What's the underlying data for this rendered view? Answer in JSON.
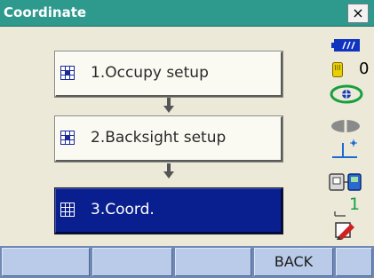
{
  "window": {
    "title": "Coordinate",
    "close_label": "×"
  },
  "menu": [
    {
      "label": "1.Occupy setup",
      "selected": false
    },
    {
      "label": "2.Backsight setup",
      "selected": false
    },
    {
      "label": "3.Coord.",
      "selected": true
    }
  ],
  "status": {
    "memory_count": "0",
    "level_value": "1",
    "battery_icon": "battery-icon",
    "memory_icon": "memory-card-icon",
    "target_icon": "target-prism-icon",
    "eye_icon": "laser-pointer-icon",
    "tilt_icon": "tilt-icon",
    "device_icon": "bluetooth-device-icon",
    "level_icon": "signal-level-icon",
    "input_icon": "input-mode-icon"
  },
  "softkeys": [
    "",
    "",
    "",
    "BACK",
    ""
  ],
  "colors": {
    "titlebar": "#2e9a8e",
    "selected": "#0a1f8f",
    "softkey_bar": "#6f88b4",
    "softkey": "#b9cbe8"
  }
}
